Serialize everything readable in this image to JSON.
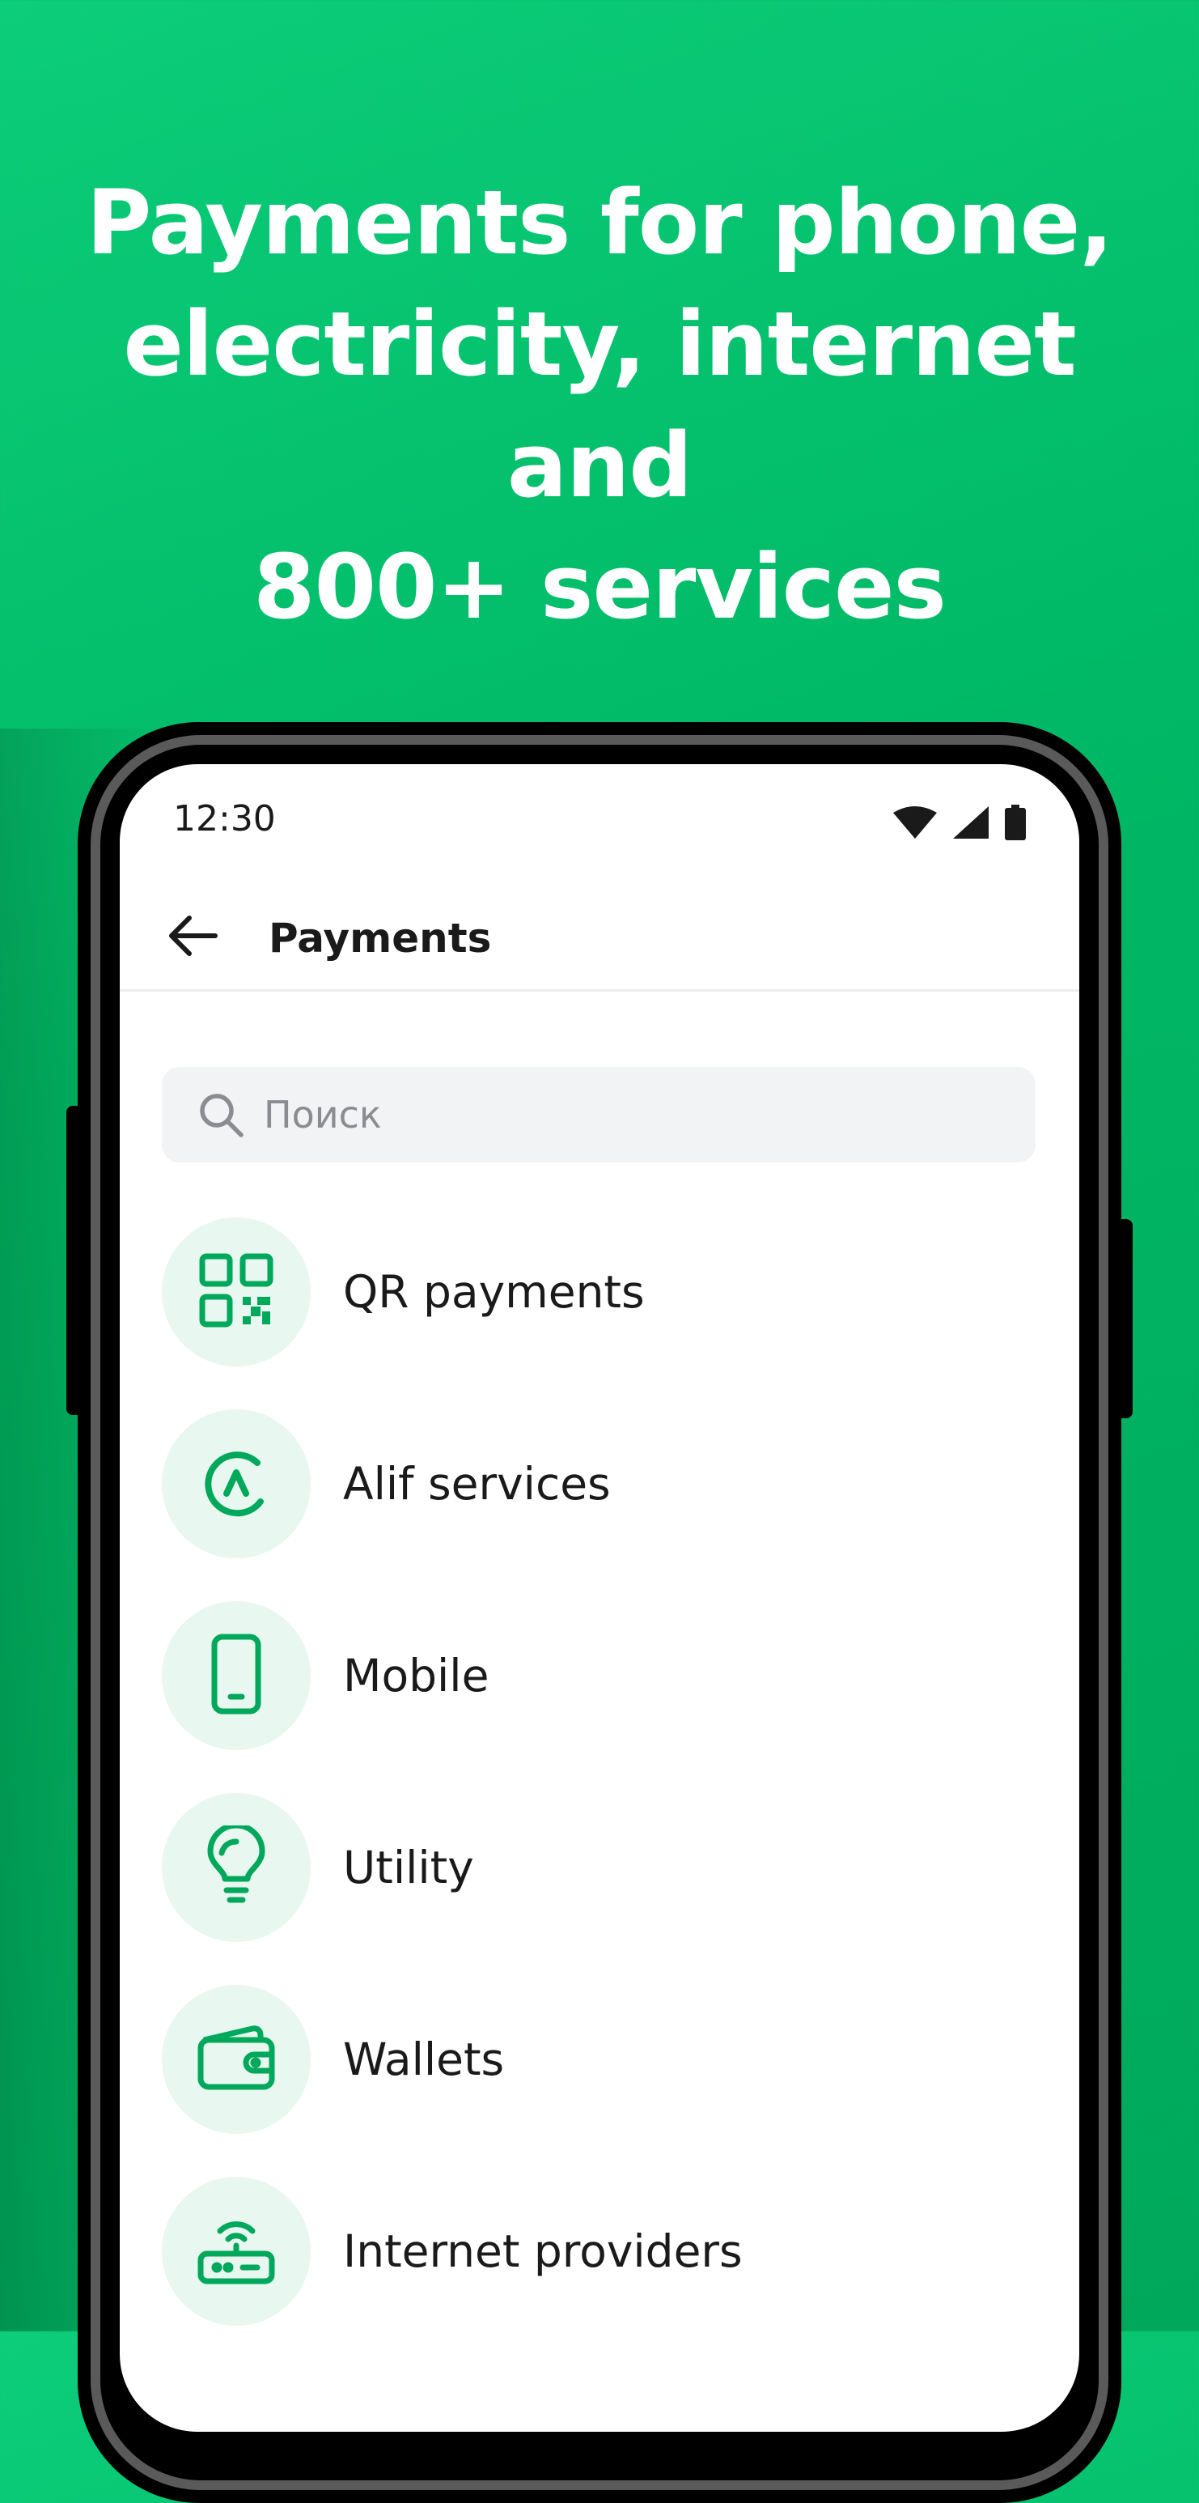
{
  "headline": {
    "line1": "Payments for phone,",
    "line2": "electricity, internet and",
    "line3": "800+ services"
  },
  "status_bar": {
    "time": "12:30",
    "icons": [
      "wifi-icon",
      "signal-icon",
      "battery-icon"
    ]
  },
  "app_bar": {
    "back_icon": "arrow-left-icon",
    "title": "Payments"
  },
  "search": {
    "placeholder": "Поиск",
    "value": "",
    "icon": "search-icon"
  },
  "categories": [
    {
      "label": "QR payments",
      "icon": "qr-code-icon"
    },
    {
      "label": "Alif services",
      "icon": "alif-logo-icon"
    },
    {
      "label": "Mobile",
      "icon": "smartphone-icon"
    },
    {
      "label": "Utility",
      "icon": "lightbulb-icon"
    },
    {
      "label": "Wallets",
      "icon": "wallet-icon"
    },
    {
      "label": "Internet providers",
      "icon": "router-icon"
    }
  ],
  "colors": {
    "brand_green": "#00B865",
    "icon_green": "#00A85C",
    "icon_bg": "#E8F7EF",
    "search_bg": "#F2F3F5"
  }
}
